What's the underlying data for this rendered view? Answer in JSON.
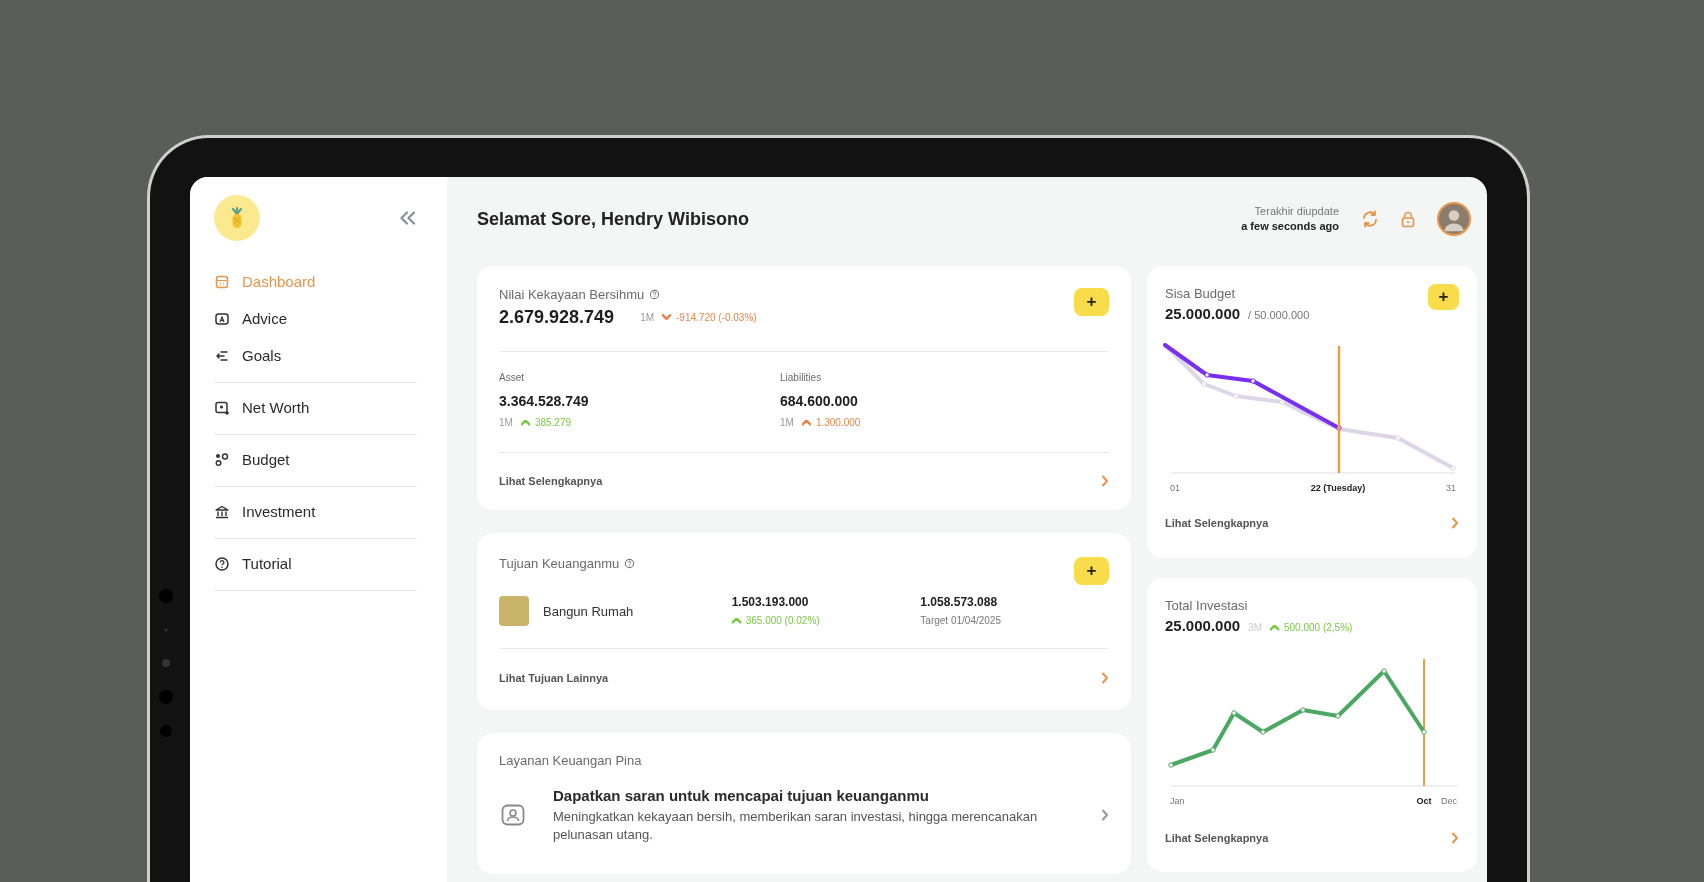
{
  "sidebar": {
    "groups": [
      {
        "items": [
          {
            "label": "Dashboard",
            "selected": true
          },
          {
            "label": "Advice",
            "selected": false
          },
          {
            "label": "Goals",
            "selected": false
          }
        ]
      },
      {
        "items": [
          {
            "label": "Net Worth",
            "selected": false
          }
        ]
      },
      {
        "items": [
          {
            "label": "Budget",
            "selected": false
          }
        ]
      },
      {
        "items": [
          {
            "label": "Investment",
            "selected": false
          }
        ]
      },
      {
        "items": [
          {
            "label": "Tutorial",
            "selected": false
          }
        ]
      }
    ]
  },
  "header": {
    "greeting": "Selamat Sore, Hendry Wibisono",
    "update_label": "Terakhir diupdate",
    "update_time": "a few seconds ago"
  },
  "net_worth": {
    "title": "Nilai Kekayaan Bersihmu",
    "add": "+",
    "value": "2.679.928.749",
    "period": "1M",
    "change": {
      "text": "-914.720 (-0.03%)",
      "kind": "down",
      "color": "#e8844a"
    },
    "breakdown": [
      {
        "label": "Asset",
        "value": "3.364.528.749",
        "period": "1M",
        "change": {
          "text": "385.279",
          "kind": "up",
          "color": "#7ac943"
        }
      },
      {
        "label": "Liabilities",
        "value": "684.600.000",
        "period": "1M",
        "change": {
          "text": "1.300.000",
          "kind": "up",
          "color": "#e8844a"
        }
      }
    ],
    "more": "Lihat Selengkapnya"
  },
  "goals": {
    "title": "Tujuan Keuanganmu",
    "add": "+",
    "items": [
      {
        "name": "Bangun Rumah",
        "saved": "1.503.193.000",
        "change": {
          "text": "365.000 (0.02%)",
          "kind": "up",
          "color": "#7ac943"
        },
        "target_amount": "1.058.573.088",
        "target_date": "Target 01/04/2025"
      }
    ],
    "more": "Lihat Tujuan Lainnya"
  },
  "services": {
    "title": "Layanan Keuangan Pina",
    "items": [
      {
        "title": "Dapatkan saran untuk mencapai tujuan keuanganmu",
        "description": "Meningkatkan kekayaan bersih, memberikan saran investasi, hingga merencanakan pelunasan utang."
      }
    ]
  },
  "budget": {
    "title": "Sisa Budget",
    "add": "+",
    "value": "25.000.000",
    "total": "/ 50.000.000",
    "x_labels": [
      {
        "text": "01",
        "current": false
      },
      {
        "text": "22 (Tuesday)",
        "current": true
      },
      {
        "text": "31",
        "current": false
      }
    ],
    "more": "Lihat Selengkapnya"
  },
  "investment": {
    "title": "Total Investasi",
    "value": "25.000.000",
    "period": "3M",
    "change": {
      "text": "500.000 (2,5%)",
      "kind": "up",
      "color": "#7ac943"
    },
    "x_labels": [
      {
        "text": "Jan",
        "current": false
      },
      {
        "text": "Oct",
        "current": true
      },
      {
        "text": "Dec",
        "current": false
      }
    ],
    "more": "Lihat Selengkapnya"
  }
}
